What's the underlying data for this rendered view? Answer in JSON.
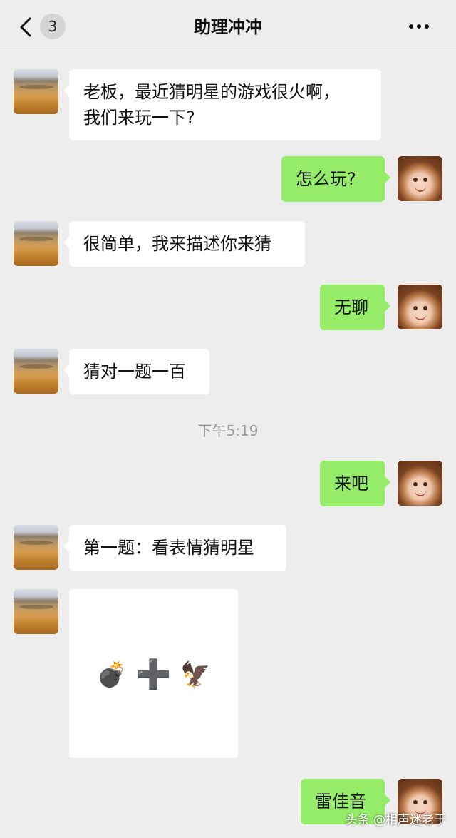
{
  "header": {
    "unread_count": "3",
    "title": "助理冲冲",
    "back_icon": "chevron-left-icon",
    "more_icon": "more-dots-icon"
  },
  "messages": [
    {
      "side": "left",
      "lines": [
        "老板，最近猜明星的游戏很火啊，",
        "我们来玩一下?"
      ]
    },
    {
      "side": "right",
      "text": "怎么玩?"
    },
    {
      "side": "left",
      "text": "很简单，我来描述你来猜"
    },
    {
      "side": "right",
      "text": "无聊"
    },
    {
      "side": "left",
      "text": "猜对一题一百"
    },
    {
      "side": "right",
      "text": "来吧"
    },
    {
      "side": "left",
      "text": "第一题：看表情猜明星"
    },
    {
      "side": "left",
      "image_emojis": [
        "💣",
        "➕",
        "🦅"
      ]
    },
    {
      "side": "right",
      "text": "雷佳音"
    }
  ],
  "timestamp": "下午5:19",
  "watermark": "头条 @相声迷老于",
  "colors": {
    "background": "#ededed",
    "bubble_left": "#ffffff",
    "bubble_right": "#95ec69"
  }
}
